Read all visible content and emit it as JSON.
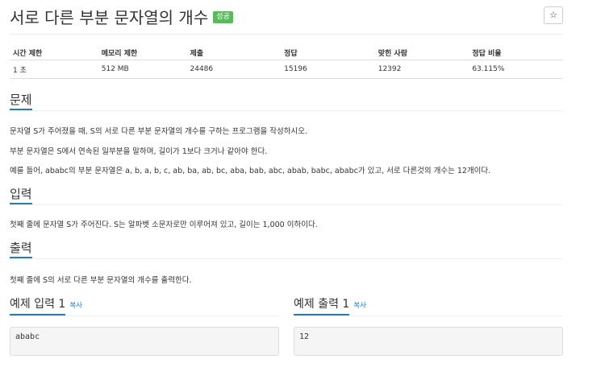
{
  "problem": {
    "title": "서로 다른 부분 문자열의 개수",
    "status_badge": "성공",
    "star_icon": "☆"
  },
  "stats": {
    "headers": [
      "시간 제한",
      "메모리 제한",
      "제출",
      "정답",
      "맞힌 사람",
      "정답 비율"
    ],
    "values": [
      "1 초",
      "512 MB",
      "24486",
      "15196",
      "12392",
      "63.115%"
    ]
  },
  "sections": {
    "problem_title": "문제",
    "problem_lines": [
      "문자열 S가 주어졌을 때, S의 서로 다른 부분 문자열의 개수를 구하는 프로그램을 작성하시오.",
      "부분 문자열은 S에서 연속된 일부분을 말하며, 길이가 1보다 크거나 같아야 한다.",
      "예를 들어, ababc의 부분 문자열은 a, b, a, b, c, ab, ba, ab, bc, aba, bab, abc, abab, babc, ababc가 있고, 서로 다른것의 개수는 12개이다."
    ],
    "input_title": "입력",
    "input_text": "첫째 줄에 문자열 S가 주어진다. S는 알파벳 소문자로만 이루어져 있고, 길이는 1,000 이하이다.",
    "output_title": "출력",
    "output_text": "첫째 줄에 S의 서로 다른 부분 문자열의 개수를 출력한다."
  },
  "examples": {
    "input_title": "예제 입력 1",
    "output_title": "예제 출력 1",
    "copy_label": "복사",
    "input_value": "ababc",
    "output_value": "12"
  }
}
